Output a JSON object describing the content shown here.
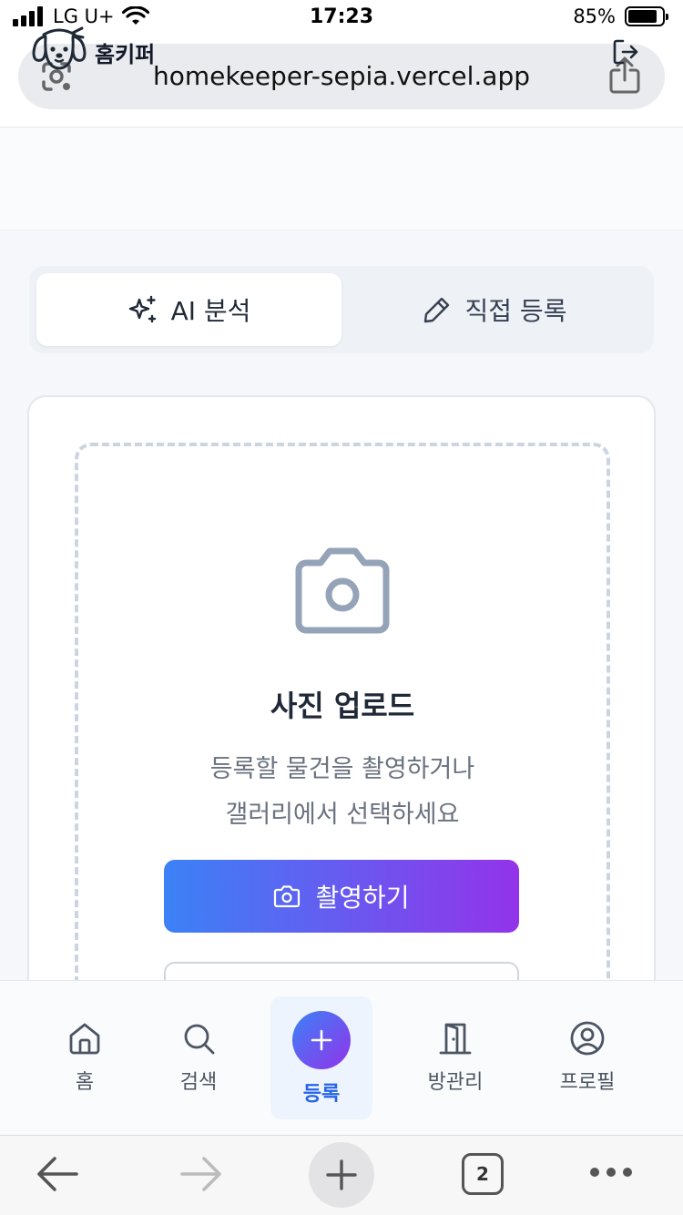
{
  "status_bar": {
    "carrier": "LG U+",
    "time": "17:23",
    "battery_percent": "85%",
    "battery_level": 0.85
  },
  "browser": {
    "url": "homekeeper-sepia.vercel.app",
    "open_tabs": "2"
  },
  "header": {
    "brand": "홈키퍼"
  },
  "mode_tabs": [
    {
      "label": "AI 분석",
      "icon": "sparkles-icon",
      "active": true
    },
    {
      "label": "직접 등록",
      "icon": "pencil-icon",
      "active": false
    }
  ],
  "upload": {
    "title": "사진 업로드",
    "description_line1": "등록할 물건을 촬영하거나",
    "description_line2": "갤러리에서 선택하세요",
    "shoot_button": "촬영하기"
  },
  "bottom_nav": [
    {
      "label": "홈",
      "icon": "home-icon",
      "active": false
    },
    {
      "label": "검색",
      "icon": "search-icon",
      "active": false
    },
    {
      "label": "등록",
      "icon": "plus-icon",
      "active": true
    },
    {
      "label": "방관리",
      "icon": "door-icon",
      "active": false
    },
    {
      "label": "프로필",
      "icon": "user-circle-icon",
      "active": false
    }
  ],
  "colors": {
    "accent_start": "#3b82f6",
    "accent_end": "#9333ea",
    "active_nav": "#2563eb"
  }
}
